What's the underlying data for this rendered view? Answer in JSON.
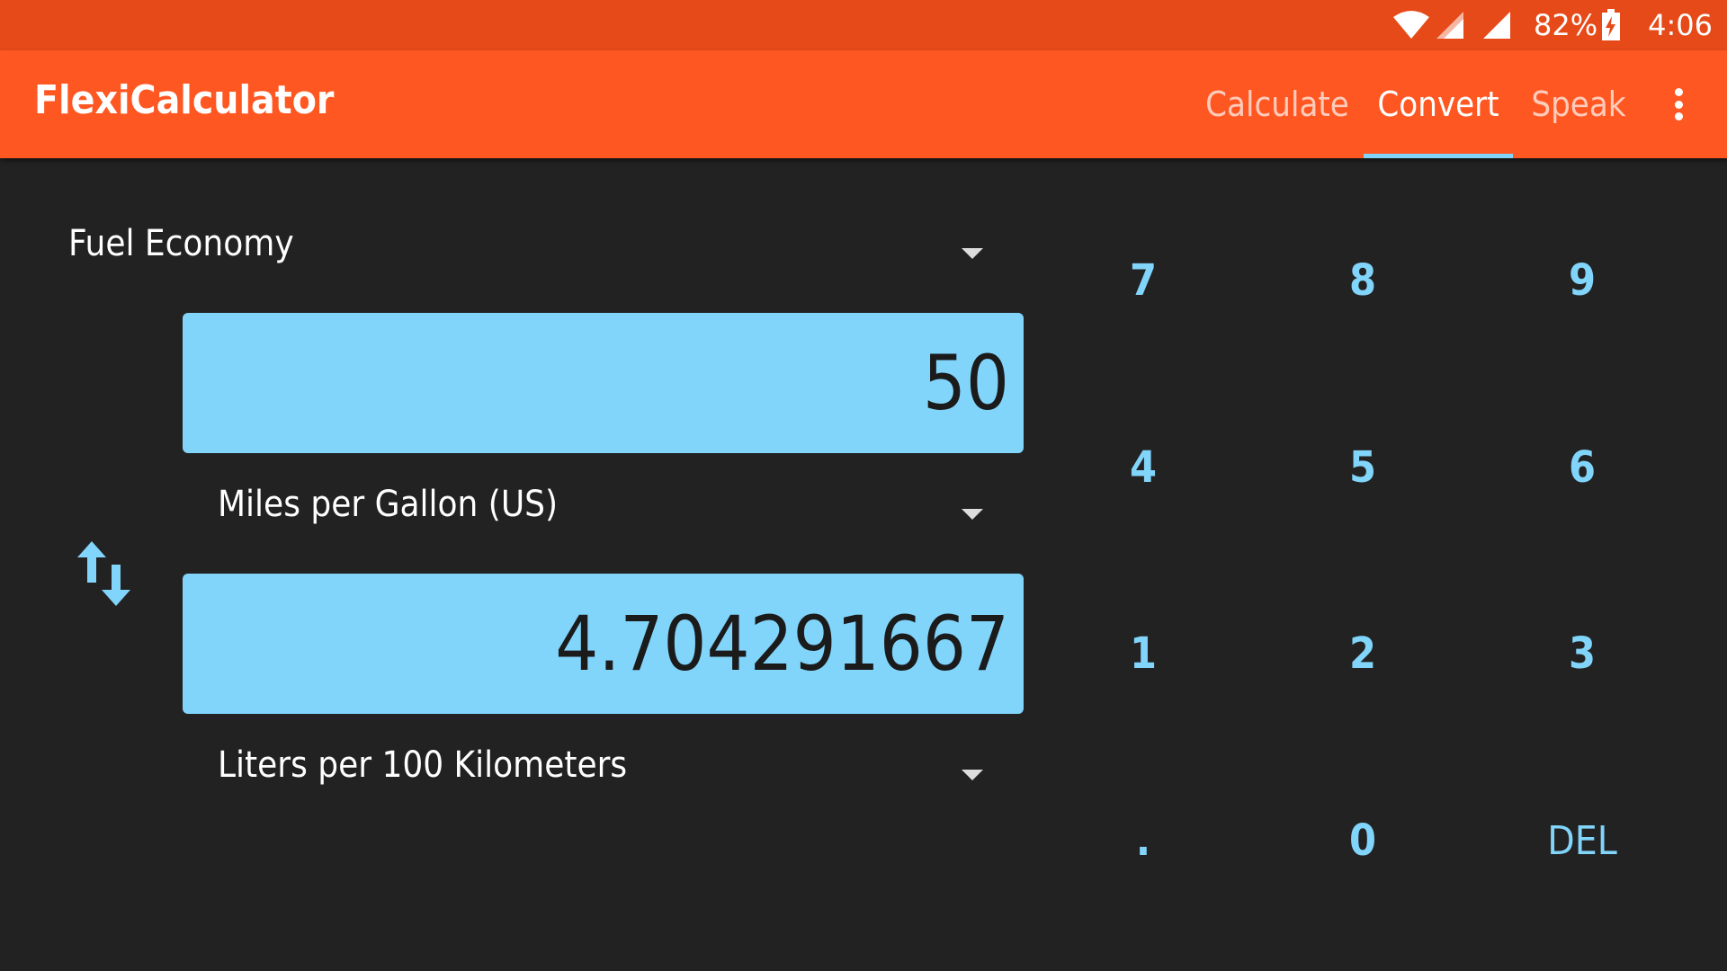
{
  "status_bar": {
    "battery": "82%",
    "time": "4:06",
    "icons": [
      "wifi-icon",
      "signal-icon",
      "signal-icon",
      "battery-charging-icon"
    ]
  },
  "app_bar": {
    "title": "FlexiCalculator",
    "tabs": [
      {
        "label": "Calculate",
        "active": false
      },
      {
        "label": "Convert",
        "active": true
      },
      {
        "label": "Speak",
        "active": false
      }
    ],
    "overflow_icon": "more-vert-icon"
  },
  "converter": {
    "category": "Fuel Economy",
    "input_value": "50",
    "input_unit": "Miles per Gallon (US)",
    "output_value": "4.704291667",
    "output_unit": "Liters per 100 Kilometers",
    "swap_icon": "swap-vertical-icon"
  },
  "keypad": {
    "keys": [
      "7",
      "8",
      "9",
      "4",
      "5",
      "6",
      "1",
      "2",
      "3",
      ".",
      "0",
      "DEL"
    ]
  },
  "colors": {
    "status_bar": "#E64A19",
    "app_bar": "#FF5722",
    "accent": "#81D4FA",
    "background": "#222222"
  }
}
